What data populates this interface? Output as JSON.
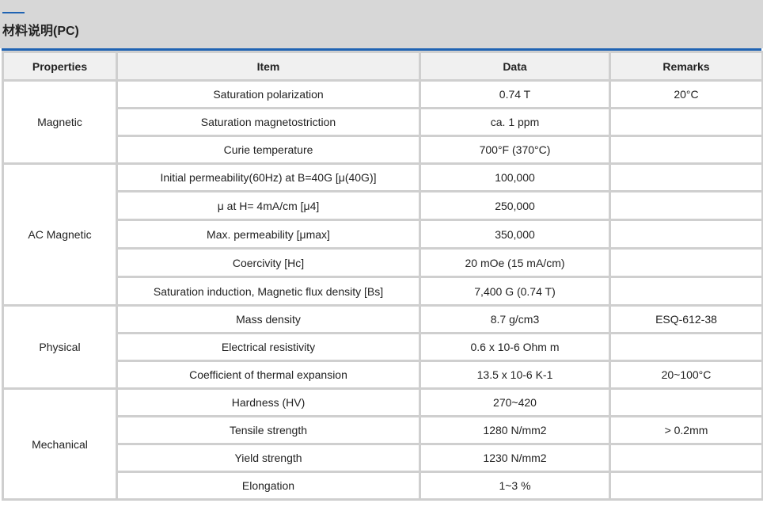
{
  "header": {
    "title": "材料说明(PC)"
  },
  "table": {
    "columns": [
      "Properties",
      "Item",
      "Data",
      "Remarks"
    ],
    "groups": [
      {
        "property": "Magnetic",
        "rows": [
          {
            "item": "Saturation polarization",
            "data": "0.74 T",
            "remarks": "20°C"
          },
          {
            "item": "Saturation magnetostriction",
            "data": "ca. 1 ppm",
            "remarks": ""
          },
          {
            "item": "Curie temperature",
            "data": "700°F (370°C)",
            "remarks": ""
          }
        ]
      },
      {
        "property": "AC Magnetic",
        "rows": [
          {
            "item": "Initial permeability(60Hz) at B=40G [μ(40G)]",
            "data": "100,000",
            "remarks": ""
          },
          {
            "item": "μ at H= 4mA/cm [μ4]",
            "data": "250,000",
            "remarks": ""
          },
          {
            "item": "Max. permeability [μmax]",
            "data": "350,000",
            "remarks": ""
          },
          {
            "item": "Coercivity [Hc]",
            "data": "20 mOe (15 mA/cm)",
            "remarks": ""
          },
          {
            "item": "Saturation induction, Magnetic flux density [Bs]",
            "data": "7,400 G (0.74 T)",
            "remarks": ""
          }
        ]
      },
      {
        "property": "Physical",
        "rows": [
          {
            "item": "Mass density",
            "data": "8.7 g/cm3",
            "remarks": "ESQ-612-38"
          },
          {
            "item": "Electrical resistivity",
            "data": "0.6 x 10-6 Ohm m",
            "remarks": ""
          },
          {
            "item": "Coefficient of thermal expansion",
            "data": "13.5 x 10-6 K-1",
            "remarks": "20~100°C"
          }
        ]
      },
      {
        "property": "Mechanical",
        "rows": [
          {
            "item": "Hardness (HV)",
            "data": "270~420",
            "remarks": ""
          },
          {
            "item": "Tensile strength",
            "data": "1280 N/mm2",
            "remarks": "> 0.2mm"
          },
          {
            "item": "Yield strength",
            "data": "1230 N/mm2",
            "remarks": ""
          },
          {
            "item": "Elongation",
            "data": "1~3 %",
            "remarks": ""
          }
        ]
      }
    ]
  },
  "colors": {
    "accent": "#1f63b3",
    "header_bg": "#d7d7d7",
    "grid": "#cfcfcf",
    "th_bg": "#f0f0f0"
  }
}
